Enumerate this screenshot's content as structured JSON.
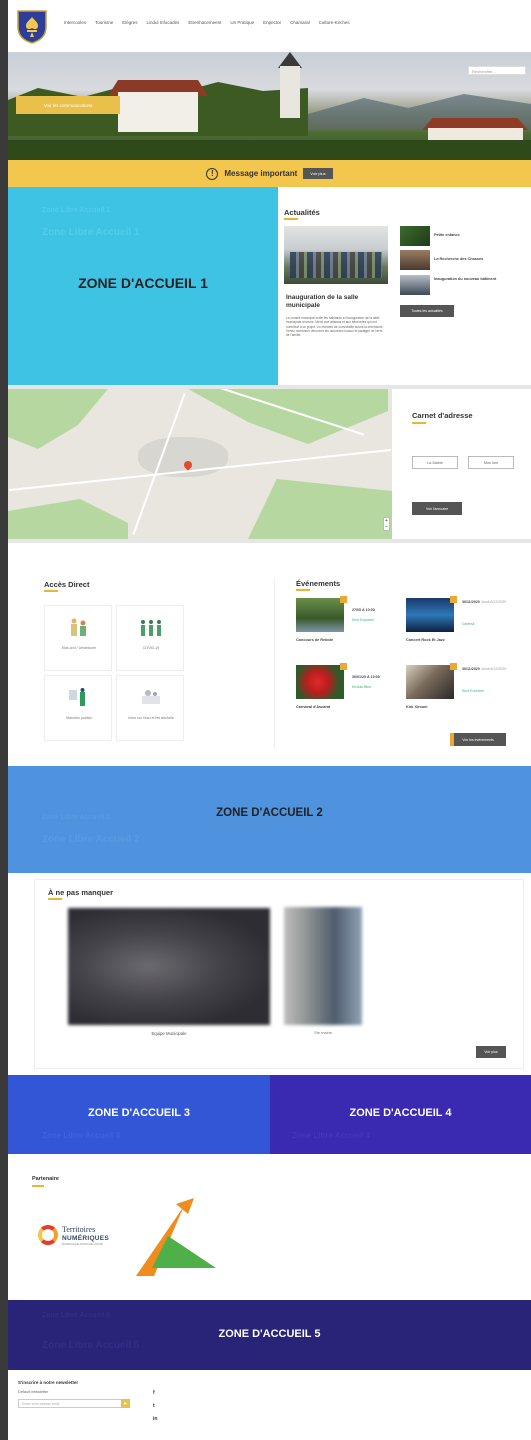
{
  "header": {
    "nav": [
      "Intercooles",
      "Tourisme",
      "Elègres",
      "Lindul Infocades",
      "Etrenhacemeent",
      "Un Pratique",
      "Enpector",
      "Chamaral",
      "Culture-Kirches"
    ]
  },
  "hero": {
    "search_placeholder": "Rechercher...",
    "button_label": "Voir les communications"
  },
  "message": {
    "icon": "!",
    "text": "Message important",
    "button_label": "Voir plus"
  },
  "zone1": {
    "title": "ZONE D'ACCUEIL 1",
    "ghost_small": "Zone Libre Accueil 1",
    "ghost_large": "Zone Libre Accueil 1"
  },
  "actualites": {
    "title": "Actualités",
    "main_title": "Inauguration de la salle municipale",
    "main_excerpt": "Le conseil municipal invite les habitants à l'inauguration de la salle municipale rénovée. Merci aux artisans et aux bénévoles qui ont contribué à ce projet. Un moment de convivialité suivra la cérémonie. Venez nombreux découvrir les nouveaux locaux et partager un verre de l'amitié.",
    "side": [
      "Petite enfance",
      "La Recherche des Chasses",
      "Inauguration du nouveau bâtiment"
    ],
    "all_label": "Toutes les actualités"
  },
  "carnet": {
    "title": "Carnet d'adresse",
    "buttons": [
      "La Mairie",
      "Mon lien"
    ],
    "directory_label": "Voir l'annuaire"
  },
  "acces_direct": {
    "title": "Accès Direct",
    "items": [
      "Etat-civil / Urbanisme",
      "COVID-19",
      "Marchés publics",
      "Infos sur l'eau et les déchets"
    ]
  },
  "evenements": {
    "title": "Événements",
    "items": [
      {
        "date": "27/05 À 10:00",
        "date_extra": "",
        "place": "Kirol Eurorroil",
        "title": "Concours de Rebote"
      },
      {
        "date": "30/11/2020",
        "date_extra": "Jeudi 8/12/2020",
        "place": "Cinéma",
        "title": "Concert Rock Et Jazz"
      },
      {
        "date": "30/01/20 À 10:00",
        "date_extra": "",
        "place": "Kirolak Bleu",
        "title": "Carnaval d'Ascarat"
      },
      {
        "date": "30/11/2020",
        "date_extra": "Jeudi 8/12/2020",
        "place": "Kirol Eurorroil",
        "title": "Kirk Xiroom"
      }
    ],
    "all_label": "Voir les événements"
  },
  "zone2": {
    "title": "ZONE D'ACCUEIL 2",
    "ghost_small": "Zone Libre Accueil 2",
    "ghost_large": "Zone Libre Accueil 2"
  },
  "a_ne_pas_manquer": {
    "title": "À ne pas manquer",
    "captions": [
      "Equipe Municipale",
      "Ste mairie"
    ],
    "more_label": "Voir plus"
  },
  "zone3": {
    "title": "ZONE D'ACCUEIL 3",
    "ghost": "Zone Libre Accueil 3"
  },
  "zone4": {
    "title": "ZONE D'ACCUEIL 4",
    "ghost": "Zone Libre Accueil 4"
  },
  "partenaire": {
    "title": "Partenaire",
    "logo_text": [
      "Territoires",
      "NUMÉRIQUES",
      "BOURGOGNE-FRANCHE-COMTÉ"
    ]
  },
  "zone5": {
    "title": "ZONE D'ACCUEIL 5",
    "ghost_small": "Zone Libre Accueil 5",
    "ghost_large": "Zone Libre Accueil 5"
  },
  "footer": {
    "newsletter_title": "S'inscrire à notre newsletter",
    "newsletter_label": "Default newsletter",
    "newsletter_placeholder": "Entrer votre adresse email",
    "submit_icon": "▸",
    "social": [
      "f",
      "t",
      "in"
    ]
  },
  "colors": {
    "accent": "#f3c64e",
    "zone1": "#3ec3e4",
    "zone2": "#4f92de",
    "zone3": "#3356d6",
    "zone4": "#3a2ab2",
    "zone5": "#2a2478"
  }
}
